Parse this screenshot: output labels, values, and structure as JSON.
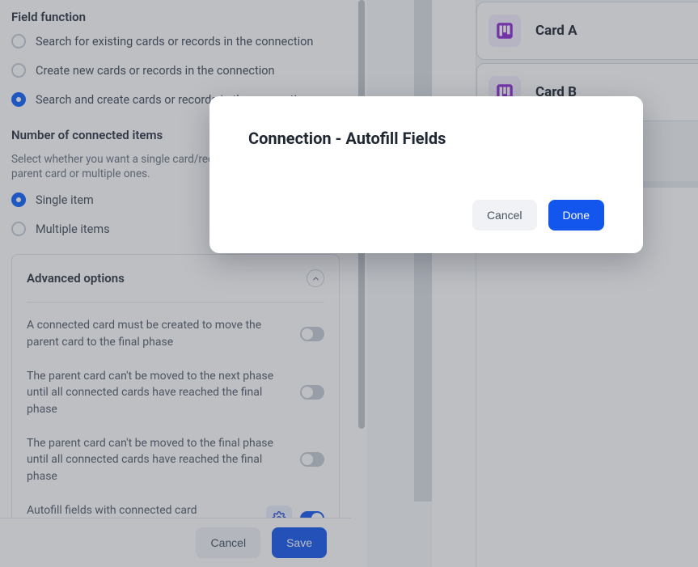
{
  "field_function": {
    "title": "Field function",
    "options": [
      {
        "label": "Search for existing cards or records in the connection",
        "checked": false
      },
      {
        "label": "Create new cards or records in the connection",
        "checked": false
      },
      {
        "label": "Search and create cards or records in the connection",
        "checked": true
      }
    ]
  },
  "connected_items": {
    "title": "Number of connected items",
    "help": "Select whether you want a single card/record connected to your parent card or multiple ones.",
    "options": [
      {
        "label": "Single item",
        "checked": true
      },
      {
        "label": "Multiple items",
        "checked": false
      }
    ]
  },
  "advanced": {
    "title": "Advanced options",
    "rows": [
      {
        "label": "A connected card must be created to move the parent card to the final phase",
        "on": false
      },
      {
        "label": "The parent card can't be moved to the next phase until all connected cards have reached the final phase",
        "on": false
      },
      {
        "label": "The parent card can't be moved to the final phase until all connected cards have reached the final phase",
        "on": false
      },
      {
        "label": "Autofill fields with connected card information",
        "on": true,
        "gear": true
      }
    ]
  },
  "form_footer": {
    "cancel": "Cancel",
    "save": "Save"
  },
  "right_cards": [
    {
      "label": "Card A"
    },
    {
      "label": "Card B"
    }
  ],
  "modal": {
    "title": "Connection - Autofill Fields",
    "cancel": "Cancel",
    "done": "Done"
  }
}
